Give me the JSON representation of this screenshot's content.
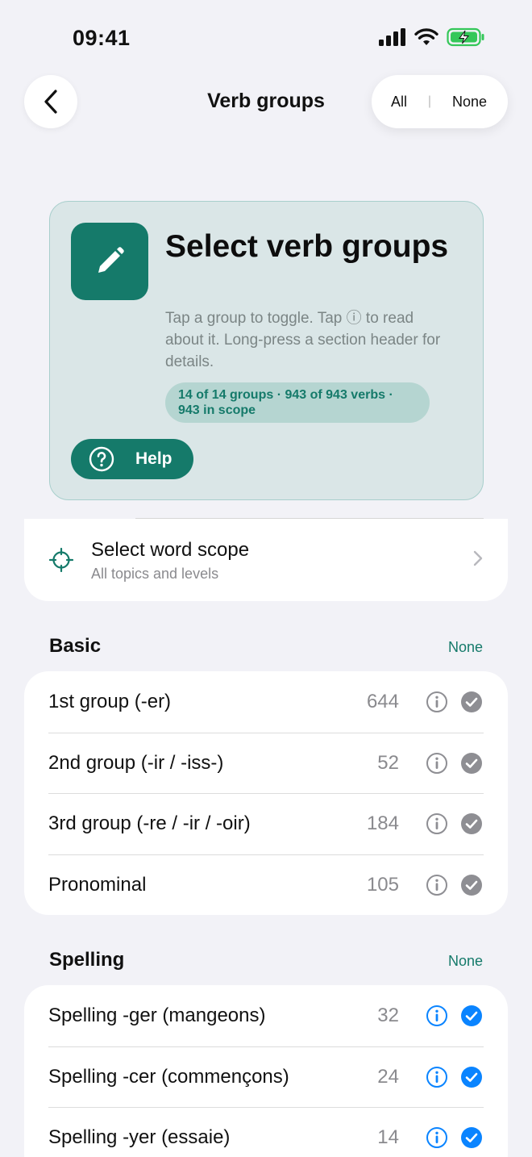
{
  "status": {
    "time": "09:41"
  },
  "nav": {
    "title": "Verb groups",
    "all_label": "All",
    "separator": "|",
    "none_label": "None"
  },
  "hero": {
    "title": "Select verb groups",
    "description": "Tap a group to toggle. Tap ⓘ to read about it. Long-press a section header for details.",
    "badge": "14 of 14 groups · 943 of 943 verbs · 943 in scope",
    "help_label": "Help",
    "accent": "#157a6a"
  },
  "scope": {
    "title": "Select word scope",
    "subtitle": "All topics and levels"
  },
  "sections": [
    {
      "title": "Basic",
      "none_label": "None",
      "rows": [
        {
          "label": "1st group (-er)",
          "count": "644",
          "checked": true,
          "style": "gray"
        },
        {
          "label": "2nd group (-ir / -iss-)",
          "count": "52",
          "checked": true,
          "style": "gray"
        },
        {
          "label": "3rd group (-re / -ir / -oir)",
          "count": "184",
          "checked": true,
          "style": "gray"
        },
        {
          "label": "Pronominal",
          "count": "105",
          "checked": true,
          "style": "gray"
        }
      ]
    },
    {
      "title": "Spelling",
      "none_label": "None",
      "rows": [
        {
          "label": "Spelling -ger (mangeons)",
          "count": "32",
          "checked": true,
          "style": "blue"
        },
        {
          "label": "Spelling -cer (commençons)",
          "count": "24",
          "checked": true,
          "style": "blue"
        },
        {
          "label": "Spelling -yer (essaie)",
          "count": "14",
          "checked": true,
          "style": "blue"
        }
      ]
    }
  ],
  "colors": {
    "gray_check": "#8e8e93",
    "blue_check": "#0a84ff"
  }
}
